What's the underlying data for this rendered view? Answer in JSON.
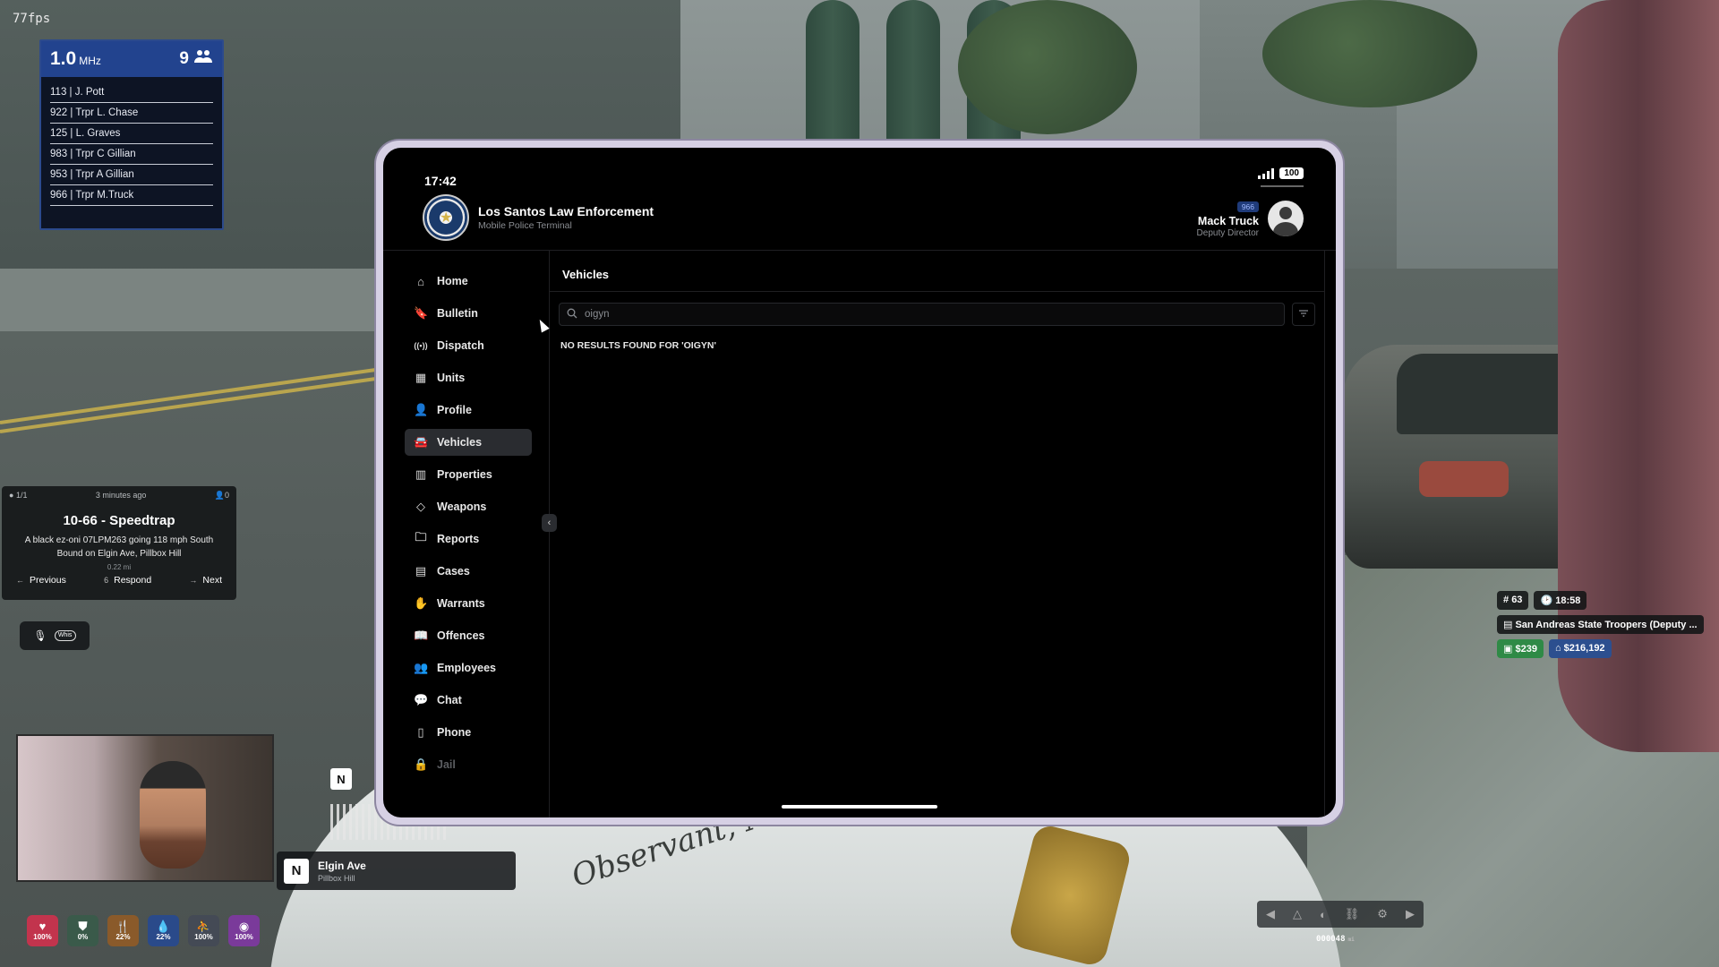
{
  "hud": {
    "fps": "77fps",
    "radio": {
      "frequency": "1.0",
      "unit": "MHz",
      "member_count": "9",
      "members": [
        "113 | J. Pott",
        "922 | Trpr L. Chase",
        "125 | L. Graves",
        "983 | Trpr C Gillian",
        "953 | Trpr A Gillian",
        "966 | Trpr M.Truck"
      ]
    },
    "notification": {
      "counter": "1/1",
      "time": "3 minutes ago",
      "units": "0",
      "title": "10-66 - Speedtrap",
      "body": "A black ez-oni 07LPM263 going 118 mph South Bound on Elgin Ave, Pillbox Hill",
      "distance": "0.22 mi",
      "previous_label": "Previous",
      "respond_key": "6",
      "respond_label": "Respond",
      "next_label": "Next"
    },
    "voice_range": "Whis",
    "compass_heading": "N",
    "location": {
      "street": "Elgin Ave",
      "area": "Pillbox Hill"
    },
    "status_bars": [
      {
        "icon": "heart-icon",
        "value": "100%",
        "color": "#c2344d"
      },
      {
        "icon": "shield-icon",
        "value": "0%",
        "color": "#3a5a4a"
      },
      {
        "icon": "food-icon",
        "value": "22%",
        "color": "#8a5a2a"
      },
      {
        "icon": "water-icon",
        "value": "22%",
        "color": "#2a4a8a"
      },
      {
        "icon": "stamina-icon",
        "value": "100%",
        "color": "#444a55"
      },
      {
        "icon": "stress-icon",
        "value": "100%",
        "color": "#7a3a9a"
      }
    ],
    "player": {
      "id": "63",
      "clock": "18:58",
      "job": "San Andreas State Troopers (Deputy ...",
      "cash": "$239",
      "bank": "$216,192"
    },
    "odometer": "000048",
    "odometer_unit": "mi"
  },
  "tablet": {
    "time": "17:42",
    "battery": "100",
    "org_name": "Los Santos Law Enforcement",
    "org_subtitle": "Mobile Police Terminal",
    "user": {
      "callsign": "966",
      "name": "Mack Truck",
      "rank": "Deputy Director"
    },
    "nav": [
      {
        "label": "Home",
        "icon": "home-icon"
      },
      {
        "label": "Bulletin",
        "icon": "bookmark-icon"
      },
      {
        "label": "Dispatch",
        "icon": "broadcast-icon"
      },
      {
        "label": "Units",
        "icon": "grid-icon"
      },
      {
        "label": "Profile",
        "icon": "user-icon"
      },
      {
        "label": "Vehicles",
        "icon": "car-icon",
        "active": true
      },
      {
        "label": "Properties",
        "icon": "building-icon"
      },
      {
        "label": "Weapons",
        "icon": "diamond-icon"
      },
      {
        "label": "Reports",
        "icon": "folder-icon"
      },
      {
        "label": "Cases",
        "icon": "case-icon"
      },
      {
        "label": "Warrants",
        "icon": "hand-icon"
      },
      {
        "label": "Offences",
        "icon": "book-icon"
      },
      {
        "label": "Employees",
        "icon": "users-icon"
      },
      {
        "label": "Chat",
        "icon": "chat-icon"
      },
      {
        "label": "Phone",
        "icon": "phone-icon"
      },
      {
        "label": "Jail",
        "icon": "lock-icon",
        "disabled": true
      }
    ],
    "page_title": "Vehicles",
    "search_value": "oigyn",
    "no_results": "NO RESULTS FOUND FOR 'OIGYN'"
  }
}
